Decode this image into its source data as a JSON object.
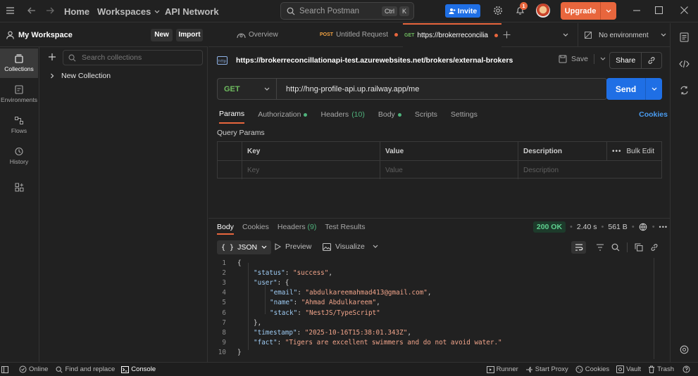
{
  "titlebar": {
    "home": "Home",
    "workspaces": "Workspaces",
    "api_network": "API Network",
    "search_placeholder": "Search Postman",
    "kbd_ctrl": "Ctrl",
    "kbd_k": "K",
    "invite": "Invite",
    "notification_count": "1",
    "upgrade": "Upgrade"
  },
  "workspace": {
    "name": "My Workspace",
    "new": "New",
    "import": "Import"
  },
  "leftnav": [
    {
      "label": "Collections",
      "icon": "collections-icon"
    },
    {
      "label": "Environments",
      "icon": "environments-icon"
    },
    {
      "label": "Flows",
      "icon": "flows-icon"
    },
    {
      "label": "History",
      "icon": "history-icon"
    }
  ],
  "collections": {
    "search_placeholder": "Search collections",
    "items": [
      "New Collection"
    ]
  },
  "tabs": {
    "overview": "Overview",
    "tab1_method": "POST",
    "tab1_label": "Untitled Request",
    "tab2_method": "GET",
    "tab2_label": "https://brokerreconcilia",
    "environment": "No environment"
  },
  "request": {
    "title": "https://brokerreconcillationapi-test.azurewebsites.net/brokers/external-brokers",
    "save": "Save",
    "share": "Share",
    "method": "GET",
    "url": "http://hng-profile-api.up.railway.app/me",
    "send": "Send",
    "tabs": [
      "Params",
      "Authorization",
      "Headers",
      "(10)",
      "Body",
      "Scripts",
      "Settings"
    ],
    "cookies": "Cookies",
    "query_params": "Query Params",
    "table_headers": [
      "Key",
      "Value",
      "Description",
      "Bulk Edit"
    ],
    "placeholders": [
      "Key",
      "Value",
      "Description"
    ]
  },
  "response": {
    "tabs": [
      "Body",
      "Cookies",
      "Headers",
      "(9)",
      "Test Results"
    ],
    "status": "200 OK",
    "time": "2.40 s",
    "size": "561 B",
    "format": "JSON",
    "preview": "Preview",
    "visualize": "Visualize",
    "lines": [
      {
        "n": "1",
        "parts": [
          [
            "p",
            "{"
          ]
        ],
        "indent": 0
      },
      {
        "n": "2",
        "parts": [
          [
            "k",
            "\"status\""
          ],
          [
            "p",
            ": "
          ],
          [
            "s",
            "\"success\""
          ],
          [
            "p",
            ","
          ]
        ],
        "indent": 1
      },
      {
        "n": "3",
        "parts": [
          [
            "k",
            "\"user\""
          ],
          [
            "p",
            ": {"
          ]
        ],
        "indent": 1
      },
      {
        "n": "4",
        "parts": [
          [
            "k",
            "\"email\""
          ],
          [
            "p",
            ": "
          ],
          [
            "s",
            "\"abdulkareemahmad413@gmail.com\""
          ],
          [
            "p",
            ","
          ]
        ],
        "indent": 2
      },
      {
        "n": "5",
        "parts": [
          [
            "k",
            "\"name\""
          ],
          [
            "p",
            ": "
          ],
          [
            "s",
            "\"Ahmad Abdulkareem\""
          ],
          [
            "p",
            ","
          ]
        ],
        "indent": 2
      },
      {
        "n": "6",
        "parts": [
          [
            "k",
            "\"stack\""
          ],
          [
            "p",
            ": "
          ],
          [
            "s",
            "\"NestJS/TypeScript\""
          ]
        ],
        "indent": 2
      },
      {
        "n": "7",
        "parts": [
          [
            "p",
            "},"
          ]
        ],
        "indent": 1
      },
      {
        "n": "8",
        "parts": [
          [
            "k",
            "\"timestamp\""
          ],
          [
            "p",
            ": "
          ],
          [
            "s",
            "\"2025-10-16T15:38:01.343Z\""
          ],
          [
            "p",
            ","
          ]
        ],
        "indent": 1
      },
      {
        "n": "9",
        "parts": [
          [
            "k",
            "\"fact\""
          ],
          [
            "p",
            ": "
          ],
          [
            "s",
            "\"Tigers are excellent swimmers and do not avoid water.\""
          ]
        ],
        "indent": 1
      },
      {
        "n": "10",
        "parts": [
          [
            "p",
            "}"
          ]
        ],
        "indent": 0
      }
    ]
  },
  "statusbar": {
    "online": "Online",
    "find_replace": "Find and replace",
    "console": "Console",
    "runner": "Runner",
    "start_proxy": "Start Proxy",
    "cookies": "Cookies",
    "vault": "Vault",
    "trash": "Trash"
  },
  "colors": {
    "accent": "#e8663d",
    "primary": "#1f6fe5",
    "success": "#5fd08f",
    "get": "#6ebb5f",
    "post": "#f0a142"
  }
}
